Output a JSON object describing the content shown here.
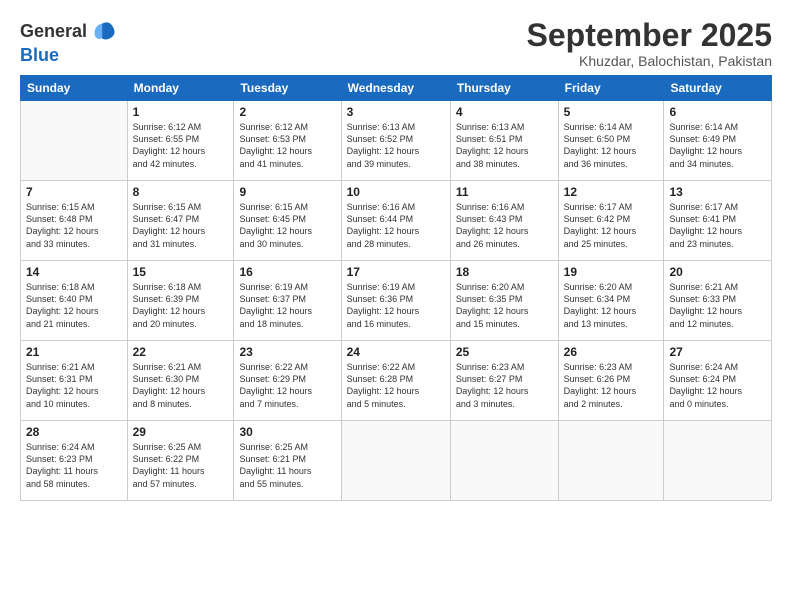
{
  "header": {
    "logo_line1": "General",
    "logo_line2": "Blue",
    "month": "September 2025",
    "location": "Khuzdar, Balochistan, Pakistan"
  },
  "weekdays": [
    "Sunday",
    "Monday",
    "Tuesday",
    "Wednesday",
    "Thursday",
    "Friday",
    "Saturday"
  ],
  "weeks": [
    [
      {
        "day": "",
        "info": ""
      },
      {
        "day": "1",
        "info": "Sunrise: 6:12 AM\nSunset: 6:55 PM\nDaylight: 12 hours\nand 42 minutes."
      },
      {
        "day": "2",
        "info": "Sunrise: 6:12 AM\nSunset: 6:53 PM\nDaylight: 12 hours\nand 41 minutes."
      },
      {
        "day": "3",
        "info": "Sunrise: 6:13 AM\nSunset: 6:52 PM\nDaylight: 12 hours\nand 39 minutes."
      },
      {
        "day": "4",
        "info": "Sunrise: 6:13 AM\nSunset: 6:51 PM\nDaylight: 12 hours\nand 38 minutes."
      },
      {
        "day": "5",
        "info": "Sunrise: 6:14 AM\nSunset: 6:50 PM\nDaylight: 12 hours\nand 36 minutes."
      },
      {
        "day": "6",
        "info": "Sunrise: 6:14 AM\nSunset: 6:49 PM\nDaylight: 12 hours\nand 34 minutes."
      }
    ],
    [
      {
        "day": "7",
        "info": "Sunrise: 6:15 AM\nSunset: 6:48 PM\nDaylight: 12 hours\nand 33 minutes."
      },
      {
        "day": "8",
        "info": "Sunrise: 6:15 AM\nSunset: 6:47 PM\nDaylight: 12 hours\nand 31 minutes."
      },
      {
        "day": "9",
        "info": "Sunrise: 6:15 AM\nSunset: 6:45 PM\nDaylight: 12 hours\nand 30 minutes."
      },
      {
        "day": "10",
        "info": "Sunrise: 6:16 AM\nSunset: 6:44 PM\nDaylight: 12 hours\nand 28 minutes."
      },
      {
        "day": "11",
        "info": "Sunrise: 6:16 AM\nSunset: 6:43 PM\nDaylight: 12 hours\nand 26 minutes."
      },
      {
        "day": "12",
        "info": "Sunrise: 6:17 AM\nSunset: 6:42 PM\nDaylight: 12 hours\nand 25 minutes."
      },
      {
        "day": "13",
        "info": "Sunrise: 6:17 AM\nSunset: 6:41 PM\nDaylight: 12 hours\nand 23 minutes."
      }
    ],
    [
      {
        "day": "14",
        "info": "Sunrise: 6:18 AM\nSunset: 6:40 PM\nDaylight: 12 hours\nand 21 minutes."
      },
      {
        "day": "15",
        "info": "Sunrise: 6:18 AM\nSunset: 6:39 PM\nDaylight: 12 hours\nand 20 minutes."
      },
      {
        "day": "16",
        "info": "Sunrise: 6:19 AM\nSunset: 6:37 PM\nDaylight: 12 hours\nand 18 minutes."
      },
      {
        "day": "17",
        "info": "Sunrise: 6:19 AM\nSunset: 6:36 PM\nDaylight: 12 hours\nand 16 minutes."
      },
      {
        "day": "18",
        "info": "Sunrise: 6:20 AM\nSunset: 6:35 PM\nDaylight: 12 hours\nand 15 minutes."
      },
      {
        "day": "19",
        "info": "Sunrise: 6:20 AM\nSunset: 6:34 PM\nDaylight: 12 hours\nand 13 minutes."
      },
      {
        "day": "20",
        "info": "Sunrise: 6:21 AM\nSunset: 6:33 PM\nDaylight: 12 hours\nand 12 minutes."
      }
    ],
    [
      {
        "day": "21",
        "info": "Sunrise: 6:21 AM\nSunset: 6:31 PM\nDaylight: 12 hours\nand 10 minutes."
      },
      {
        "day": "22",
        "info": "Sunrise: 6:21 AM\nSunset: 6:30 PM\nDaylight: 12 hours\nand 8 minutes."
      },
      {
        "day": "23",
        "info": "Sunrise: 6:22 AM\nSunset: 6:29 PM\nDaylight: 12 hours\nand 7 minutes."
      },
      {
        "day": "24",
        "info": "Sunrise: 6:22 AM\nSunset: 6:28 PM\nDaylight: 12 hours\nand 5 minutes."
      },
      {
        "day": "25",
        "info": "Sunrise: 6:23 AM\nSunset: 6:27 PM\nDaylight: 12 hours\nand 3 minutes."
      },
      {
        "day": "26",
        "info": "Sunrise: 6:23 AM\nSunset: 6:26 PM\nDaylight: 12 hours\nand 2 minutes."
      },
      {
        "day": "27",
        "info": "Sunrise: 6:24 AM\nSunset: 6:24 PM\nDaylight: 12 hours\nand 0 minutes."
      }
    ],
    [
      {
        "day": "28",
        "info": "Sunrise: 6:24 AM\nSunset: 6:23 PM\nDaylight: 11 hours\nand 58 minutes."
      },
      {
        "day": "29",
        "info": "Sunrise: 6:25 AM\nSunset: 6:22 PM\nDaylight: 11 hours\nand 57 minutes."
      },
      {
        "day": "30",
        "info": "Sunrise: 6:25 AM\nSunset: 6:21 PM\nDaylight: 11 hours\nand 55 minutes."
      },
      {
        "day": "",
        "info": ""
      },
      {
        "day": "",
        "info": ""
      },
      {
        "day": "",
        "info": ""
      },
      {
        "day": "",
        "info": ""
      }
    ]
  ]
}
